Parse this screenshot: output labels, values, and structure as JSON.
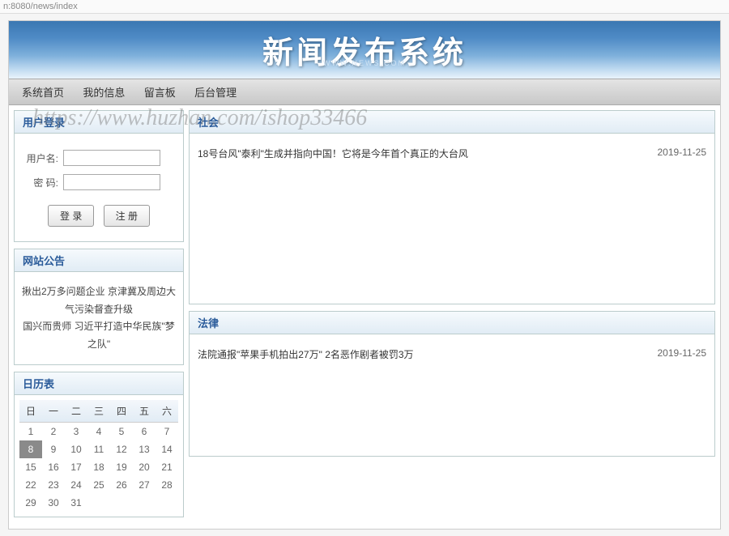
{
  "address": "n:8080/news/index",
  "banner": {
    "title": "新闻发布系统",
    "sub": "WWW.NEWS.COM"
  },
  "nav": {
    "items": [
      "系统首页",
      "我的信息",
      "留言板",
      "后台管理"
    ]
  },
  "login": {
    "title": "用户登录",
    "username_label": "用户名:",
    "password_label": "密  码:",
    "login_btn": "登 录",
    "register_btn": "注 册"
  },
  "announcement": {
    "title": "网站公告",
    "items": [
      "揪出2万多问题企业 京津冀及周边大气污染督查升级",
      "国兴而贵师 习近平打造中华民族\"梦之队\""
    ]
  },
  "calendar_panel": {
    "title": "日历表",
    "headers": [
      "日",
      "一",
      "二",
      "三",
      "四",
      "五",
      "六"
    ],
    "weeks": [
      [
        "1",
        "2",
        "3",
        "4",
        "5",
        "6",
        "7"
      ],
      [
        "8",
        "9",
        "10",
        "11",
        "12",
        "13",
        "14"
      ],
      [
        "15",
        "16",
        "17",
        "18",
        "19",
        "20",
        "21"
      ],
      [
        "22",
        "23",
        "24",
        "25",
        "26",
        "27",
        "28"
      ],
      [
        "29",
        "30",
        "31",
        "",
        "",
        "",
        ""
      ]
    ],
    "selected": "8"
  },
  "sections": [
    {
      "title": "社会",
      "items": [
        {
          "title": "18号台风\"泰利\"生成并指向中国！它将是今年首个真正的大台风",
          "date": "2019-11-25"
        }
      ]
    },
    {
      "title": "法律",
      "items": [
        {
          "title": "法院通报\"苹果手机拍出27万\" 2名恶作剧者被罚3万",
          "date": "2019-11-25"
        }
      ]
    }
  ],
  "watermark": "https://www.huzhan.com/ishop33466"
}
